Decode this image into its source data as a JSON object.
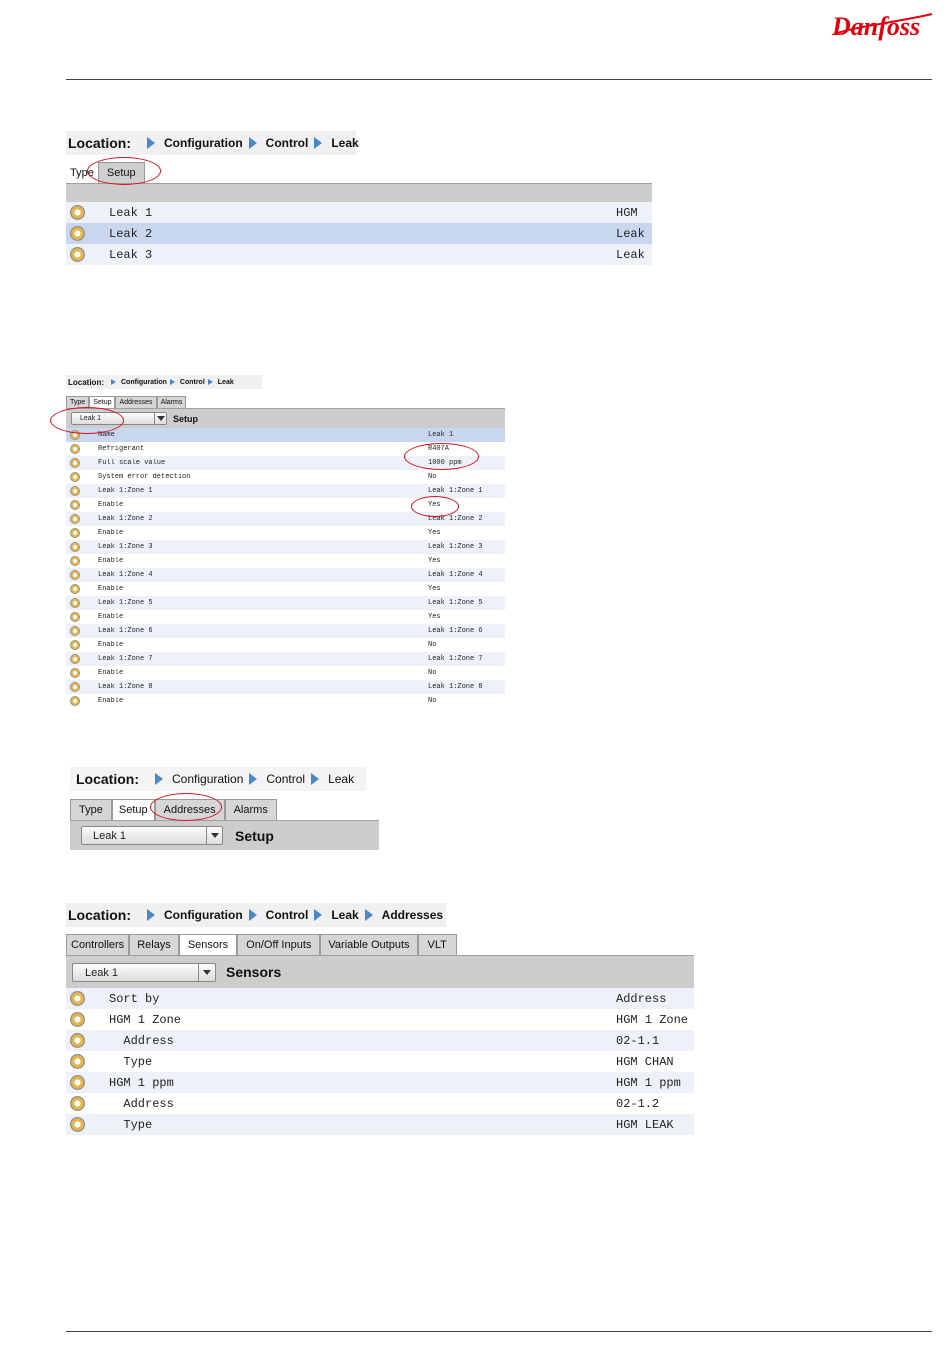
{
  "brand": {
    "logo_text": "Danfoss",
    "color": "#e2000f"
  },
  "colors": {
    "accent": "#4a86c8",
    "annotation": "#d2141e",
    "row_selected": "#c8d7ee"
  },
  "screen1": {
    "location_label": "Location:",
    "crumbs": [
      "Configuration",
      "Control",
      "Leak"
    ],
    "tabs": [
      "Type",
      "Setup"
    ],
    "rows": [
      {
        "name": "Leak 1",
        "value": "HGM"
      },
      {
        "name": "Leak 2",
        "value": "Leak"
      },
      {
        "name": "Leak 3",
        "value": "Leak"
      }
    ]
  },
  "screen2": {
    "location_label": "Location:",
    "crumbs": [
      "Configuration",
      "Control",
      "Leak"
    ],
    "tabs": [
      "Type",
      "Setup",
      "Addresses",
      "Alarms"
    ],
    "select_value": "Leak 1",
    "header_title": "Setup",
    "rows": [
      {
        "name": "Name",
        "value": "Leak 1"
      },
      {
        "name": "Refrigerant",
        "value": "R407A"
      },
      {
        "name": "Full scale value",
        "value": "1000 ppm"
      },
      {
        "name": "System error detection",
        "value": "No"
      },
      {
        "name": "Leak 1:Zone 1",
        "value": "Leak 1:Zone 1"
      },
      {
        "name": "Enable",
        "value": "Yes"
      },
      {
        "name": "Leak 1:Zone 2",
        "value": "Leak 1:Zone 2"
      },
      {
        "name": "Enable",
        "value": "Yes"
      },
      {
        "name": "Leak 1:Zone 3",
        "value": "Leak 1:Zone 3"
      },
      {
        "name": "Enable",
        "value": "Yes"
      },
      {
        "name": "Leak 1:Zone 4",
        "value": "Leak 1:Zone 4"
      },
      {
        "name": "Enable",
        "value": "Yes"
      },
      {
        "name": "Leak 1:Zone 5",
        "value": "Leak 1:Zone 5"
      },
      {
        "name": "Enable",
        "value": "Yes"
      },
      {
        "name": "Leak 1:Zone 6",
        "value": "Leak 1:Zone 6"
      },
      {
        "name": "Enable",
        "value": "No"
      },
      {
        "name": "Leak 1:Zone 7",
        "value": "Leak 1:Zone 7"
      },
      {
        "name": "Enable",
        "value": "No"
      },
      {
        "name": "Leak 1:Zone 8",
        "value": "Leak 1:Zone 8"
      },
      {
        "name": "Enable",
        "value": "No"
      }
    ]
  },
  "screen3": {
    "location_label": "Location:",
    "crumbs": [
      "Configuration",
      "Control",
      "Leak"
    ],
    "tabs": [
      "Type",
      "Setup",
      "Addresses",
      "Alarms"
    ],
    "select_value": "Leak 1",
    "header_title": "Setup"
  },
  "screen4": {
    "location_label": "Location:",
    "crumbs": [
      "Configuration",
      "Control",
      "Leak",
      "Addresses"
    ],
    "tabs": [
      "Controllers",
      "Relays",
      "Sensors",
      "On/Off Inputs",
      "Variable Outputs",
      "VLT"
    ],
    "select_value": "Leak 1",
    "header_title": "Sensors",
    "rows": [
      {
        "name": "Sort by",
        "value": "Address"
      },
      {
        "name": "HGM 1 Zone",
        "value": "HGM 1 Zone"
      },
      {
        "name": "  Address",
        "value": "02-1.1"
      },
      {
        "name": "  Type",
        "value": "HGM CHAN"
      },
      {
        "name": "HGM 1 ppm",
        "value": "HGM 1 ppm"
      },
      {
        "name": "  Address",
        "value": "02-1.2"
      },
      {
        "name": "  Type",
        "value": "HGM LEAK"
      }
    ]
  }
}
